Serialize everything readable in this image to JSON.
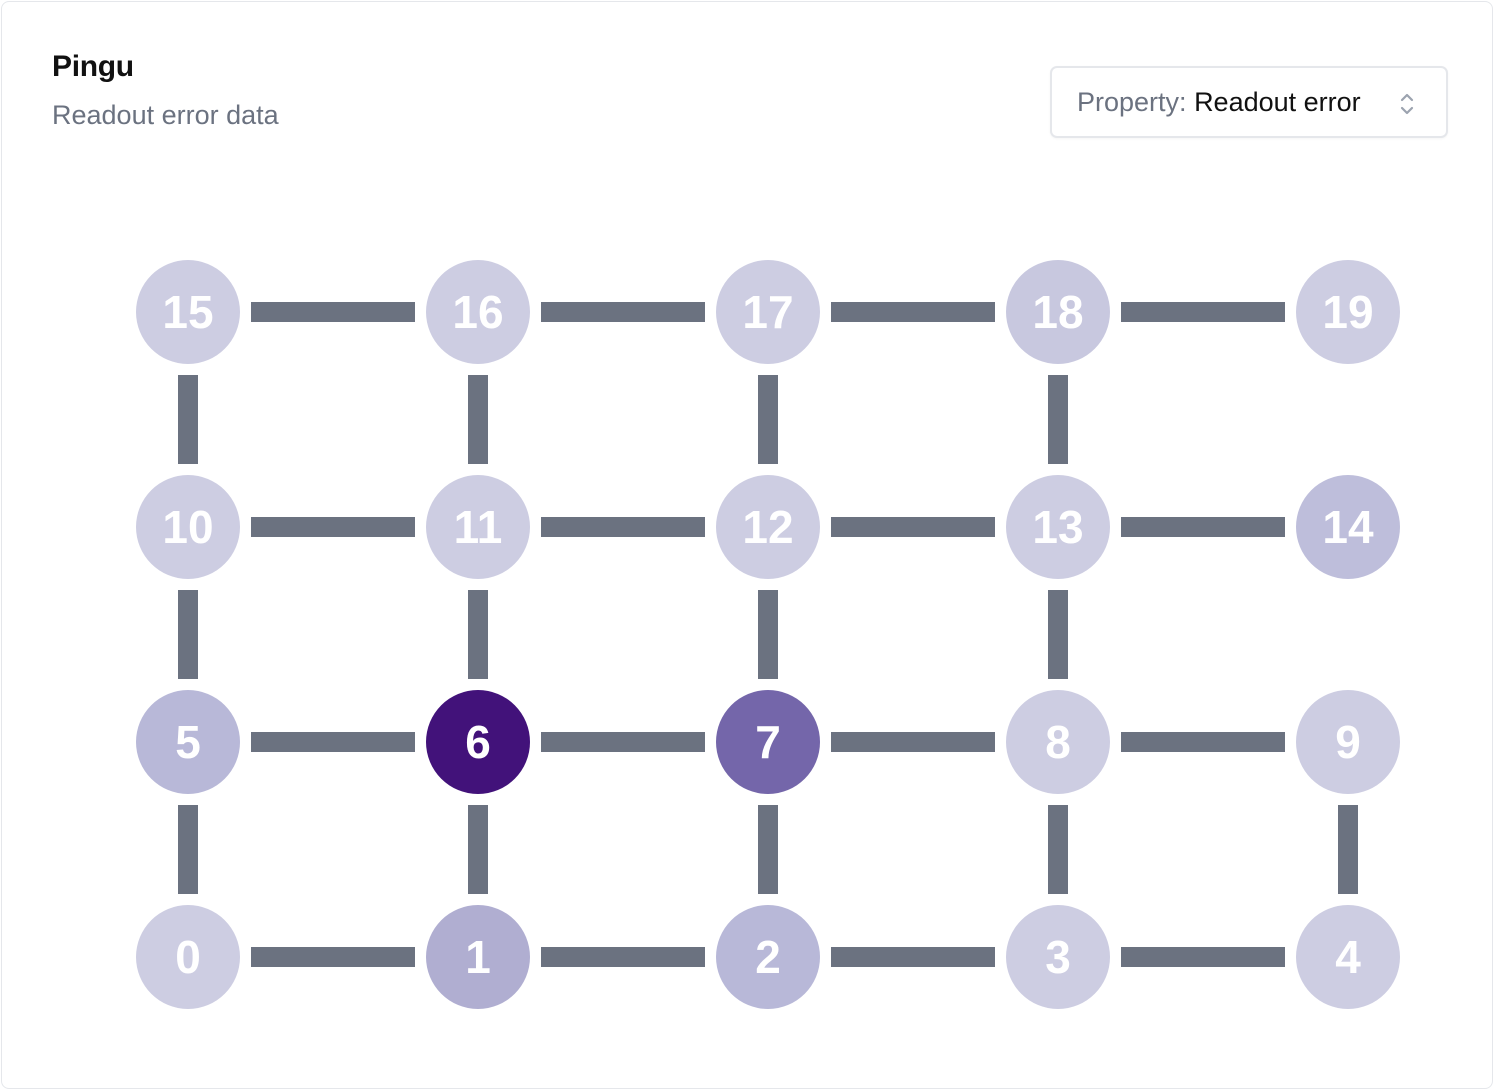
{
  "header": {
    "title": "Pingu",
    "subtitle": "Readout error data"
  },
  "property_select": {
    "prefix": "Property:",
    "value": "Readout error",
    "icon": "chevron-up-down-icon"
  },
  "chart_data": {
    "type": "graph",
    "colors": {
      "edge": "#6b7280",
      "label_light": "#ffffff",
      "node_darkest": "#42127a"
    },
    "nodes": [
      {
        "id": 15,
        "row": 0,
        "col": 0,
        "color": "#cdcde2"
      },
      {
        "id": 16,
        "row": 0,
        "col": 1,
        "color": "#cdcde2"
      },
      {
        "id": 17,
        "row": 0,
        "col": 2,
        "color": "#cdcde2"
      },
      {
        "id": 18,
        "row": 0,
        "col": 3,
        "color": "#c8c8df"
      },
      {
        "id": 19,
        "row": 0,
        "col": 4,
        "color": "#cdcde2"
      },
      {
        "id": 10,
        "row": 1,
        "col": 0,
        "color": "#cdcde2"
      },
      {
        "id": 11,
        "row": 1,
        "col": 1,
        "color": "#cdcde2"
      },
      {
        "id": 12,
        "row": 1,
        "col": 2,
        "color": "#cdcde2"
      },
      {
        "id": 13,
        "row": 1,
        "col": 3,
        "color": "#cdcde2"
      },
      {
        "id": 14,
        "row": 1,
        "col": 4,
        "color": "#bebedb"
      },
      {
        "id": 5,
        "row": 2,
        "col": 0,
        "color": "#b8b8d8"
      },
      {
        "id": 6,
        "row": 2,
        "col": 1,
        "color": "#42127a"
      },
      {
        "id": 7,
        "row": 2,
        "col": 2,
        "color": "#7466aa"
      },
      {
        "id": 8,
        "row": 2,
        "col": 3,
        "color": "#cdcde2"
      },
      {
        "id": 9,
        "row": 2,
        "col": 4,
        "color": "#cdcde2"
      },
      {
        "id": 0,
        "row": 3,
        "col": 0,
        "color": "#cdcde2"
      },
      {
        "id": 1,
        "row": 3,
        "col": 1,
        "color": "#b0aed1"
      },
      {
        "id": 2,
        "row": 3,
        "col": 2,
        "color": "#b8b8d8"
      },
      {
        "id": 3,
        "row": 3,
        "col": 3,
        "color": "#cdcde2"
      },
      {
        "id": 4,
        "row": 3,
        "col": 4,
        "color": "#cdcde2"
      }
    ],
    "edges": [
      [
        15,
        16
      ],
      [
        16,
        17
      ],
      [
        17,
        18
      ],
      [
        18,
        19
      ],
      [
        15,
        10
      ],
      [
        16,
        11
      ],
      [
        17,
        12
      ],
      [
        18,
        13
      ],
      [
        10,
        11
      ],
      [
        11,
        12
      ],
      [
        12,
        13
      ],
      [
        13,
        14
      ],
      [
        10,
        5
      ],
      [
        11,
        6
      ],
      [
        12,
        7
      ],
      [
        13,
        8
      ],
      [
        5,
        6
      ],
      [
        6,
        7
      ],
      [
        7,
        8
      ],
      [
        8,
        9
      ],
      [
        5,
        0
      ],
      [
        6,
        1
      ],
      [
        7,
        2
      ],
      [
        8,
        3
      ],
      [
        9,
        4
      ],
      [
        0,
        1
      ],
      [
        1,
        2
      ],
      [
        2,
        3
      ],
      [
        3,
        4
      ]
    ]
  }
}
